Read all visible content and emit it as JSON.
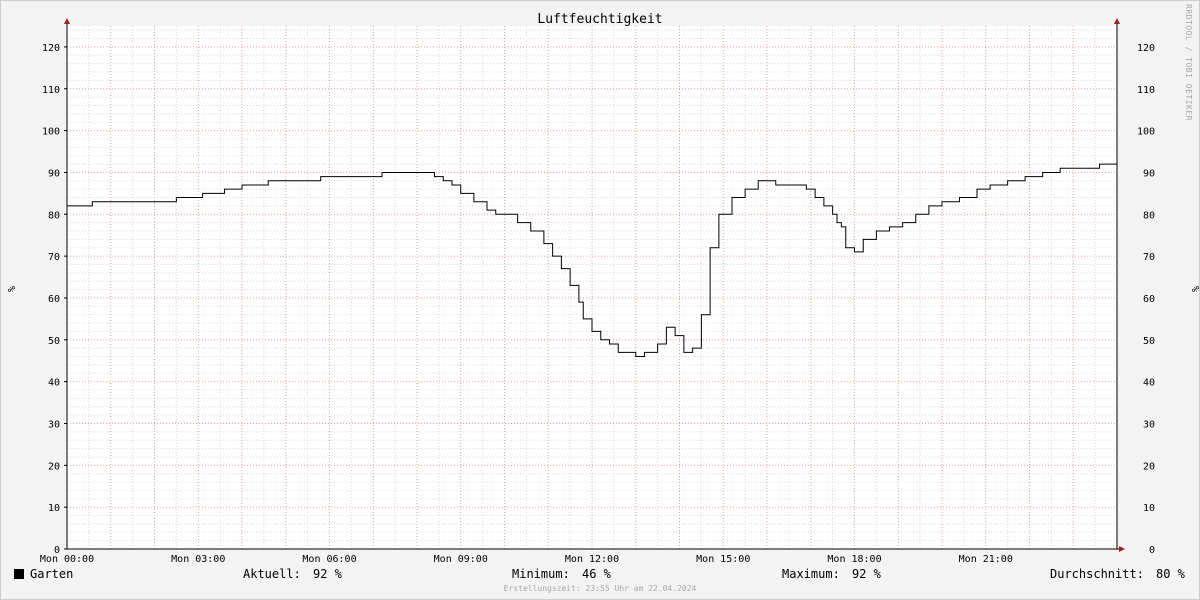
{
  "chart_data": {
    "type": "line",
    "title": "Luftfeuchtigkeit",
    "ylabel": "%",
    "ylim": [
      0,
      125
    ],
    "y_ticks": [
      0,
      10,
      20,
      30,
      40,
      50,
      60,
      70,
      80,
      90,
      100,
      110,
      120
    ],
    "x_range_hours": [
      0,
      24
    ],
    "x_tick_hours": [
      0,
      3,
      6,
      9,
      12,
      15,
      18,
      21
    ],
    "x_tick_labels": [
      "Mon 00:00",
      "Mon 03:00",
      "Mon 06:00",
      "Mon 09:00",
      "Mon 12:00",
      "Mon 15:00",
      "Mon 18:00",
      "Mon 21:00"
    ],
    "grid": true,
    "series": [
      {
        "name": "Garten",
        "color": "#000000",
        "x": [
          0,
          0.58,
          1.4,
          1.98,
          2.5,
          3.1,
          3.6,
          4.0,
          4.6,
          5.2,
          5.5,
          5.8,
          6.1,
          6.7,
          7.2,
          7.8,
          8.1,
          8.4,
          8.6,
          8.8,
          9.0,
          9.3,
          9.6,
          9.8,
          10.0,
          10.3,
          10.6,
          10.9,
          11.1,
          11.3,
          11.5,
          11.7,
          11.8,
          12.0,
          12.2,
          12.4,
          12.6,
          12.8,
          13.0,
          13.2,
          13.5,
          13.7,
          13.9,
          14.1,
          14.3,
          14.5,
          14.7,
          14.9,
          15.2,
          15.5,
          15.8,
          16.2,
          16.5,
          16.7,
          16.9,
          17.1,
          17.3,
          17.5,
          17.6,
          17.7,
          17.8,
          18.0,
          18.2,
          18.5,
          18.8,
          19.1,
          19.4,
          19.7,
          20.0,
          20.4,
          20.8,
          21.1,
          21.5,
          21.9,
          22.3,
          22.7,
          23.0,
          23.3,
          23.6,
          24.0
        ],
        "y": [
          82,
          83,
          83,
          83,
          84,
          85,
          86,
          87,
          88,
          88,
          88,
          89,
          89,
          89,
          90,
          90,
          90,
          89,
          88,
          87,
          85,
          83,
          81,
          80,
          80,
          78,
          76,
          73,
          70,
          67,
          63,
          59,
          55,
          52,
          50,
          49,
          47,
          47,
          46,
          47,
          49,
          53,
          51,
          47,
          48,
          56,
          72,
          80,
          84,
          86,
          88,
          87,
          87,
          87,
          86,
          84,
          82,
          80,
          78,
          77,
          72,
          71,
          74,
          76,
          77,
          78,
          80,
          82,
          83,
          84,
          86,
          87,
          88,
          89,
          90,
          91,
          91,
          91,
          92,
          92
        ]
      }
    ],
    "legend": {
      "series_label": "Garten",
      "current_label": "Aktuell:",
      "current_value": "92 %",
      "min_label": "Minimum:",
      "min_value": "46 %",
      "max_label": "Maximum:",
      "max_value": "92 %",
      "avg_label": "Durchschnitt:",
      "avg_value": "80 %"
    },
    "footer": "Erstellungszeit: 23:55 Uhr am 22.04.2024",
    "credit": "RRDTOOL / TOBI OETIKER"
  },
  "colors": {
    "background": "#f3f3f3",
    "plot_background": "#ffffff",
    "major_grid": "#e8a0a0",
    "minor_grid": "#d8d8d8",
    "line": "#000000",
    "axis_arrow": "#a02020"
  }
}
